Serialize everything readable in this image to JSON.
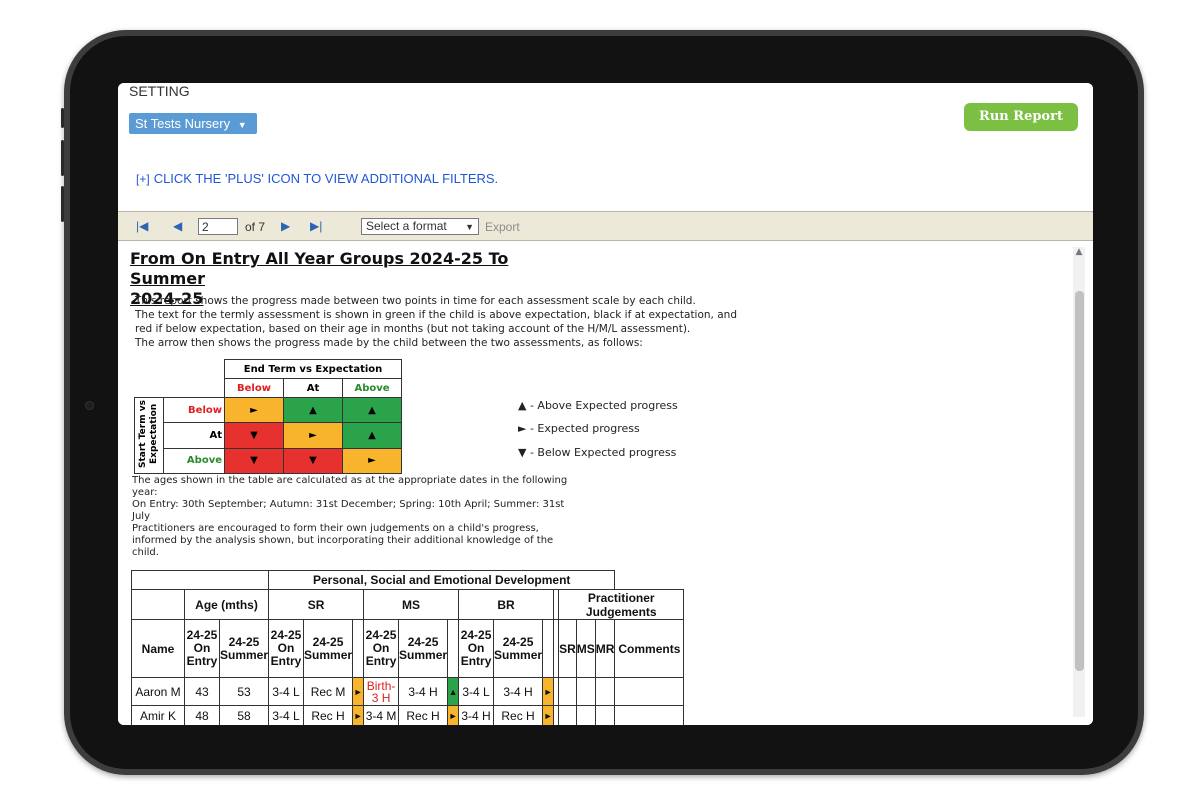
{
  "filters": {
    "setting_label": "SETTING",
    "school_value": "St Tests Nursery",
    "run_button": "Run Report",
    "more_filters_plus": "[+]",
    "more_filters_text": "CLICK THE 'PLUS' ICON TO VIEW ADDITIONAL FILTERS."
  },
  "toolbar": {
    "page_value": "2",
    "page_total": "of 7",
    "format_placeholder": "Select a format",
    "export_label": "Export"
  },
  "report": {
    "title_line1": "From On Entry All Year Groups 2024-25 To Summer",
    "title_line2": "2024-25",
    "intro": [
      "This report shows the progress made between two points in time for each assessment scale by each child.",
      "The text for the termly assessment is shown in green if the child is above expectation, black if at expectation, and",
      "red if below expectation, based on their age in months (but not taking account of the H/M/L assessment).",
      "The arrow then shows the progress made by the child between the two assessments, as follows:"
    ],
    "key": {
      "end_header": "End Term vs Expectation",
      "start_header": "Start Term vs Expectation",
      "cols": [
        "Below",
        "At",
        "Above"
      ],
      "rows": [
        "Below",
        "At",
        "Above"
      ]
    },
    "legend": [
      "▲ - Above Expected progress",
      "► - Expected progress",
      "▼ - Below Expected progress"
    ],
    "notes": [
      "The ages shown in the table are calculated as at the appropriate dates in the following year:",
      "On Entry: 30th September; Autumn: 31st December; Spring: 10th April; Summer: 31st July",
      "Practitioners are encouraged to form their own judgements on a child's progress, informed by the analysis shown, but incorporating their additional knowledge of the child."
    ],
    "table": {
      "area_header": "Personal, Social and Emotional Development",
      "age_header": "Age (mths)",
      "sr_header": "SR",
      "ms_header": "MS",
      "br_header": "BR",
      "pj_header": "Practitioner Judgements",
      "name_header": "Name",
      "on_entry_header": "24-25 On Entry",
      "summer_header": "24-25 Summer",
      "pj_cols": [
        "SR",
        "MS",
        "MR",
        "Comments"
      ],
      "rows": [
        {
          "name": "Aaron M",
          "age_entry": "43",
          "age_summer": "53",
          "sr_entry": "3-4 L",
          "sr_summer": "Rec M",
          "sr_arrow": "►",
          "ms_entry": "Birth-3 H",
          "ms_summer": "3-4 H",
          "ms_arrow": "▲",
          "br_entry": "3-4 L",
          "br_summer": "3-4 H",
          "br_arrow": "►"
        },
        {
          "name": "Amir K",
          "age_entry": "48",
          "age_summer": "58",
          "sr_entry": "3-4 L",
          "sr_summer": "Rec H",
          "sr_arrow": "►",
          "ms_entry": "3-4 M",
          "ms_summer": "Rec H",
          "ms_arrow": "►",
          "br_entry": "3-4 H",
          "br_summer": "Rec H",
          "br_arrow": "►"
        }
      ]
    }
  },
  "colors": {
    "school_select_bg": "#5b9bd5",
    "run_button_bg": "#7bc043",
    "link": "#1f57d6",
    "toolbar_bg": "#ece9d8",
    "progress_above": "#2aa34a",
    "progress_expected": "#f7b42c",
    "progress_below": "#e6312e"
  }
}
